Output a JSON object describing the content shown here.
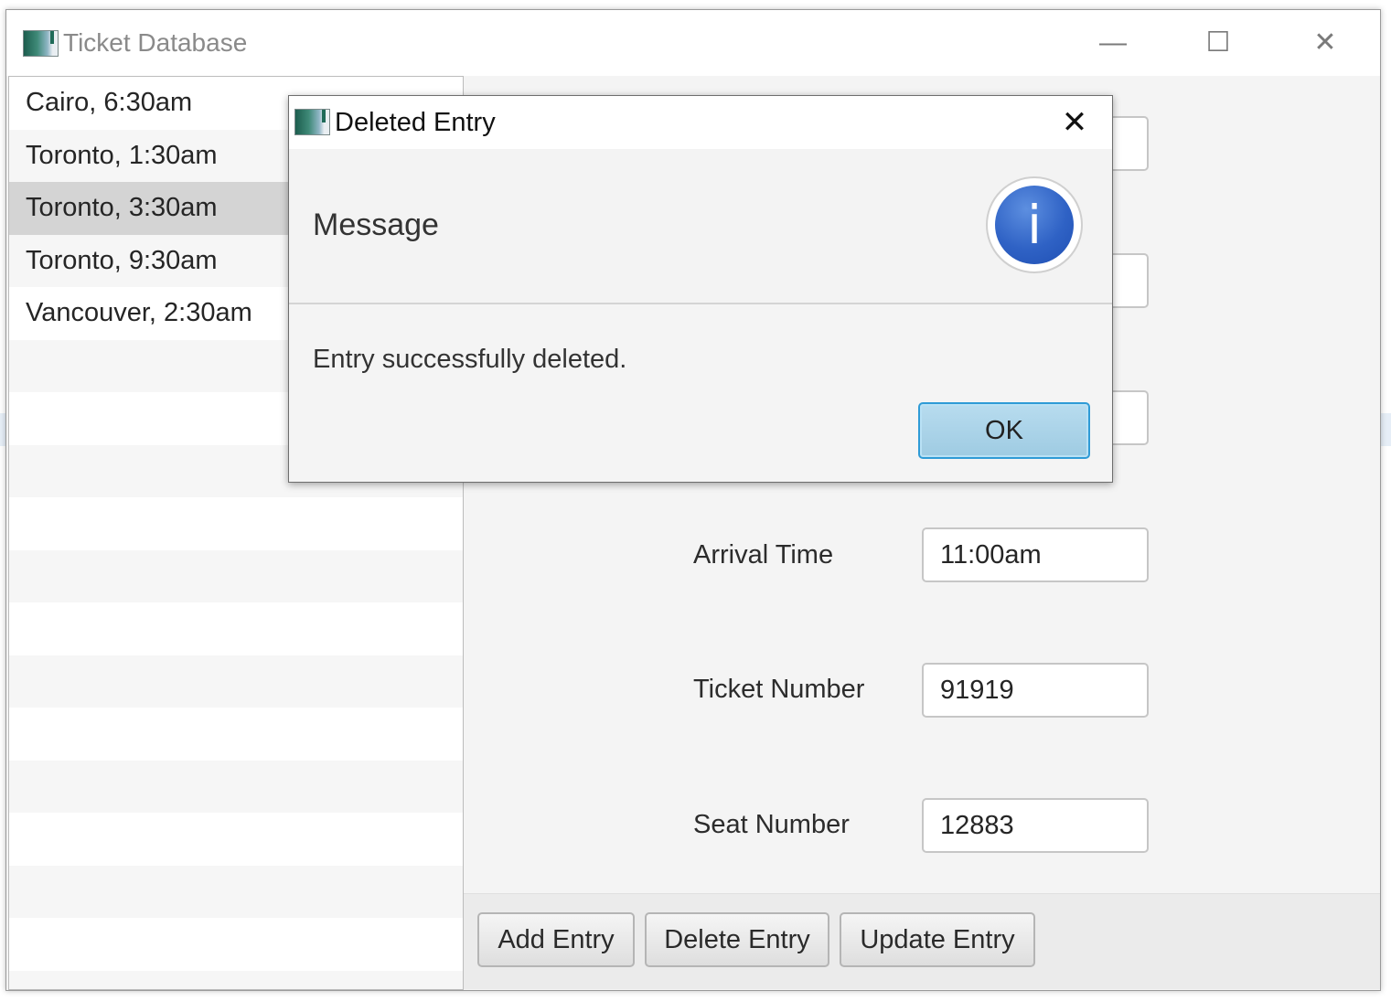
{
  "main_window": {
    "title": "Ticket Database",
    "controls": {
      "minimize": "—",
      "maximize": "☐",
      "close": "✕"
    }
  },
  "ticket_list": {
    "items": [
      "Cairo, 6:30am",
      "Toronto, 1:30am",
      "Toronto, 3:30am",
      "Toronto, 9:30am",
      "Vancouver, 2:30am"
    ],
    "selected_index": 2
  },
  "form": {
    "arrival_time_label": "Arrival Time",
    "arrival_time_value": "11:00am",
    "ticket_number_label": "Ticket Number",
    "ticket_number_value": "91919",
    "seat_number_label": "Seat Number",
    "seat_number_value": "12883"
  },
  "buttons": {
    "add": "Add Entry",
    "delete": "Delete Entry",
    "update": "Update Entry"
  },
  "dialog": {
    "title": "Deleted Entry",
    "close": "✕",
    "header": "Message",
    "icon": "information-icon",
    "icon_glyph": "i",
    "content": "Entry successfully deleted.",
    "ok": "OK"
  },
  "colors": {
    "selection": "#d4d4d4",
    "ok_focus_border": "#2f9bd6",
    "info_icon_blue": "#2f62c5"
  }
}
